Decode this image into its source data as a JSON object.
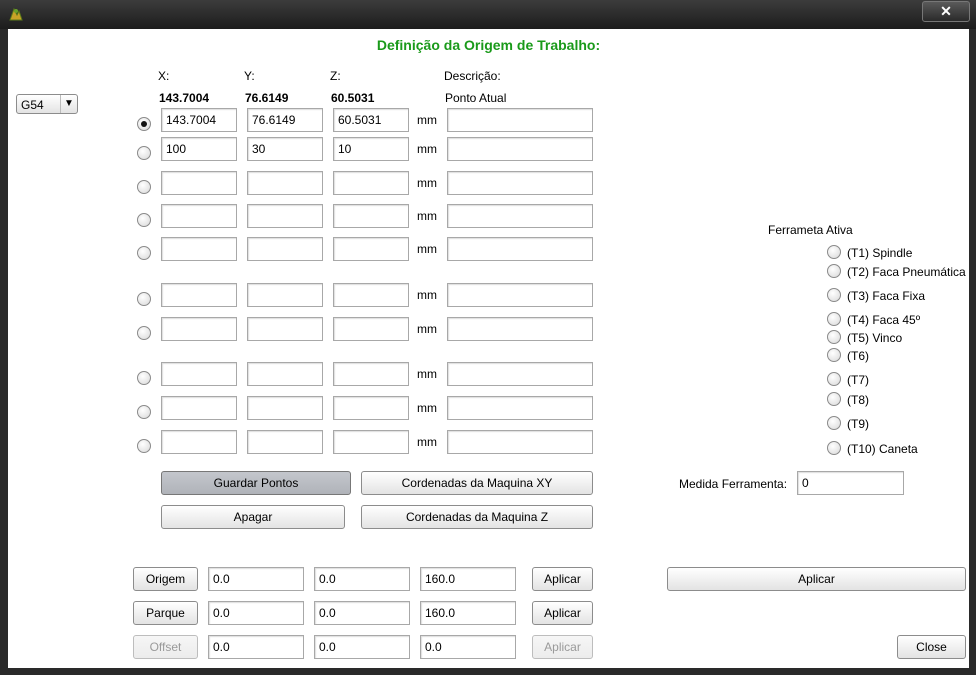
{
  "window": {
    "title": ""
  },
  "heading": "Definição da Origem de Trabalho:",
  "work_offset_select": {
    "value": "G54"
  },
  "columns": {
    "x": "X:",
    "y": "Y:",
    "z": "Z:",
    "desc": "Descrição:"
  },
  "current": {
    "x": "143.7004",
    "y": "76.6149",
    "z": "60.5031",
    "desc": "Ponto Atual"
  },
  "unit": "mm",
  "rows": [
    {
      "selected": true,
      "x": "143.7004",
      "y": "76.6149",
      "z": "60.5031",
      "desc": ""
    },
    {
      "selected": false,
      "x": "100",
      "y": "30",
      "z": "10",
      "desc": ""
    },
    {
      "selected": false,
      "x": "",
      "y": "",
      "z": "",
      "desc": ""
    },
    {
      "selected": false,
      "x": "",
      "y": "",
      "z": "",
      "desc": ""
    },
    {
      "selected": false,
      "x": "",
      "y": "",
      "z": "",
      "desc": ""
    },
    {
      "selected": false,
      "x": "",
      "y": "",
      "z": "",
      "desc": ""
    },
    {
      "selected": false,
      "x": "",
      "y": "",
      "z": "",
      "desc": ""
    },
    {
      "selected": false,
      "x": "",
      "y": "",
      "z": "",
      "desc": ""
    },
    {
      "selected": false,
      "x": "",
      "y": "",
      "z": "",
      "desc": ""
    },
    {
      "selected": false,
      "x": "",
      "y": "",
      "z": "",
      "desc": ""
    }
  ],
  "buttons": {
    "guardar": "Guardar Pontos",
    "coord_xy": "Cordenadas da Maquina XY",
    "apagar": "Apagar",
    "coord_z": "Cordenadas da Maquina Z",
    "aplicar": "Aplicar",
    "close": "Close"
  },
  "bottom_rows": [
    {
      "label": "Origem",
      "x": "0.0",
      "y": "0.0",
      "z": "160.0",
      "enabled": true
    },
    {
      "label": "Parque",
      "x": "0.0",
      "y": "0.0",
      "z": "160.0",
      "enabled": true
    },
    {
      "label": "Offset",
      "x": "0.0",
      "y": "0.0",
      "z": "0.0",
      "enabled": false
    }
  ],
  "tool_panel": {
    "title": "Ferrameta Ativa",
    "tools": [
      "(T1) Spindle",
      "(T2) Faca Pneumática",
      "(T3) Faca Fixa",
      "(T4) Faca 45º",
      "(T5) Vinco",
      "(T6)",
      "(T7)",
      "(T8)",
      "(T9)",
      "(T10) Caneta"
    ],
    "measure_label": "Medida Ferramenta:",
    "measure_value": "0",
    "apply_label": "Aplicar"
  }
}
